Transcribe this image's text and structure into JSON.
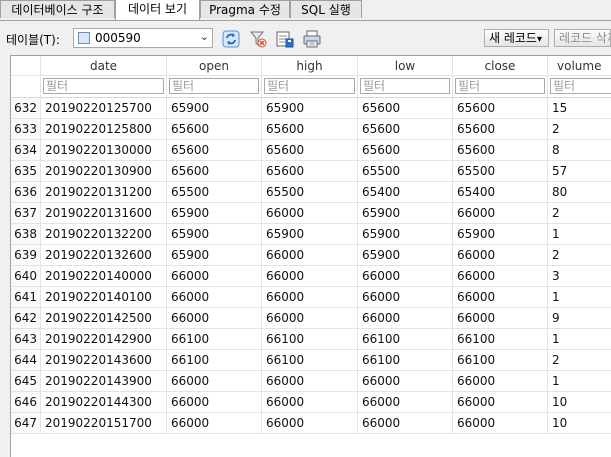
{
  "tabs": [
    {
      "label": "데이터베이스 구조"
    },
    {
      "label": "데이터 보기"
    },
    {
      "label": "Pragma 수정"
    },
    {
      "label": "SQL 실행"
    }
  ],
  "toolbar": {
    "table_label": "테이블(T):",
    "table_value": "000590",
    "new_record": "새 레코드",
    "delete_record": "레코드 삭제"
  },
  "grid": {
    "columns": [
      "date",
      "open",
      "high",
      "low",
      "close",
      "volume"
    ],
    "filter_placeholder": "필터",
    "rows": [
      {
        "n": "632",
        "date": "20190220125700",
        "open": "65900",
        "high": "65900",
        "low": "65600",
        "close": "65600",
        "volume": "15"
      },
      {
        "n": "633",
        "date": "20190220125800",
        "open": "65600",
        "high": "65600",
        "low": "65600",
        "close": "65600",
        "volume": "2"
      },
      {
        "n": "634",
        "date": "20190220130000",
        "open": "65600",
        "high": "65600",
        "low": "65600",
        "close": "65600",
        "volume": "8"
      },
      {
        "n": "635",
        "date": "20190220130900",
        "open": "65600",
        "high": "65600",
        "low": "65500",
        "close": "65500",
        "volume": "57"
      },
      {
        "n": "636",
        "date": "20190220131200",
        "open": "65500",
        "high": "65500",
        "low": "65400",
        "close": "65400",
        "volume": "80"
      },
      {
        "n": "637",
        "date": "20190220131600",
        "open": "65900",
        "high": "66000",
        "low": "65900",
        "close": "66000",
        "volume": "2"
      },
      {
        "n": "638",
        "date": "20190220132200",
        "open": "65900",
        "high": "65900",
        "low": "65900",
        "close": "65900",
        "volume": "1"
      },
      {
        "n": "639",
        "date": "20190220132600",
        "open": "65900",
        "high": "66000",
        "low": "65900",
        "close": "66000",
        "volume": "2"
      },
      {
        "n": "640",
        "date": "20190220140000",
        "open": "66000",
        "high": "66000",
        "low": "66000",
        "close": "66000",
        "volume": "3"
      },
      {
        "n": "641",
        "date": "20190220140100",
        "open": "66000",
        "high": "66000",
        "low": "66000",
        "close": "66000",
        "volume": "1"
      },
      {
        "n": "642",
        "date": "20190220142500",
        "open": "66000",
        "high": "66000",
        "low": "66000",
        "close": "66000",
        "volume": "9"
      },
      {
        "n": "643",
        "date": "20190220142900",
        "open": "66100",
        "high": "66100",
        "low": "66100",
        "close": "66100",
        "volume": "1"
      },
      {
        "n": "644",
        "date": "20190220143600",
        "open": "66100",
        "high": "66100",
        "low": "66100",
        "close": "66100",
        "volume": "2"
      },
      {
        "n": "645",
        "date": "20190220143900",
        "open": "66000",
        "high": "66000",
        "low": "66000",
        "close": "66000",
        "volume": "1"
      },
      {
        "n": "646",
        "date": "20190220144300",
        "open": "66000",
        "high": "66000",
        "low": "66000",
        "close": "66000",
        "volume": "10"
      },
      {
        "n": "647",
        "date": "20190220151700",
        "open": "66000",
        "high": "66000",
        "low": "66000",
        "close": "66000",
        "volume": "10"
      }
    ]
  }
}
